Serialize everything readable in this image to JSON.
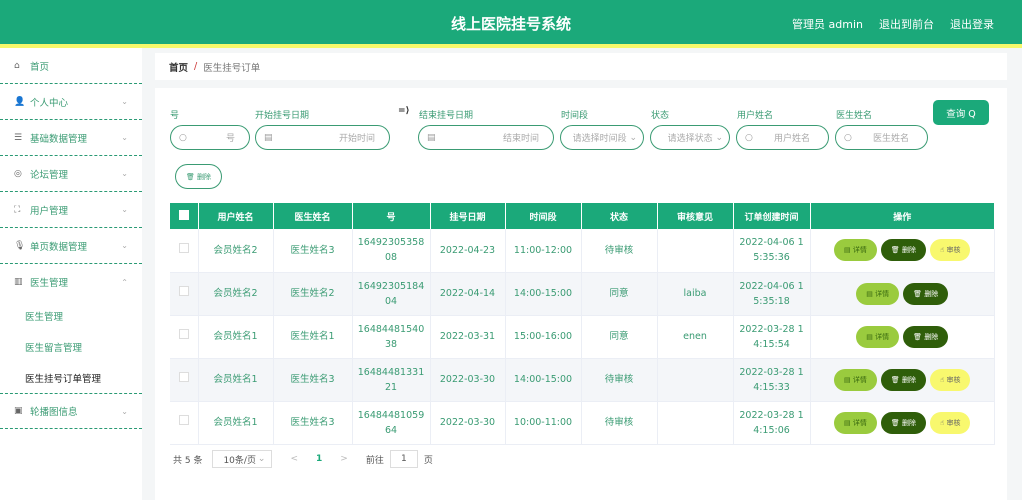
{
  "header": {
    "title": "线上医院挂号系统",
    "user": "管理员 admin",
    "front": "退出到前台",
    "logout": "退出登录"
  },
  "sidebar": {
    "items": [
      {
        "label": "首页",
        "icon": "home-icon",
        "glyph": "⌂"
      },
      {
        "label": "个人中心",
        "icon": "user-icon",
        "glyph": "👤"
      },
      {
        "label": "基础数据管理",
        "icon": "menu-icon",
        "glyph": "☰"
      },
      {
        "label": "论坛管理",
        "icon": "chat-icon",
        "glyph": "◎"
      },
      {
        "label": "用户管理",
        "icon": "frame-icon",
        "glyph": "⛶"
      },
      {
        "label": "单页数据管理",
        "icon": "mic-icon",
        "glyph": "🎙"
      },
      {
        "label": "医生管理",
        "icon": "chart-icon",
        "glyph": "▥"
      }
    ],
    "subitems": [
      "医生管理",
      "医生留言管理",
      "医生挂号订单管理"
    ],
    "last": {
      "label": "轮播图信息",
      "icon": "image-icon",
      "glyph": "▣"
    }
  },
  "breadcrumb": {
    "home": "首页",
    "sep": "/",
    "current": "医生挂号订单"
  },
  "filters": {
    "no": {
      "label": "号",
      "placeholder": "号"
    },
    "start": {
      "label": "开始挂号日期",
      "placeholder": "开始时间"
    },
    "arrow": "=⟩",
    "end": {
      "label": "结束挂号日期",
      "placeholder": "结束时间"
    },
    "slot": {
      "label": "时间段",
      "placeholder": "请选择时间段"
    },
    "status": {
      "label": "状态",
      "placeholder": "请选择状态"
    },
    "user": {
      "label": "用户姓名",
      "placeholder": "用户姓名"
    },
    "doctor": {
      "label": "医生姓名",
      "placeholder": "医生姓名"
    },
    "query": "查询 Q",
    "delete": "🗑 删除"
  },
  "table": {
    "headers": [
      "用户姓名",
      "医生姓名",
      "号",
      "挂号日期",
      "时间段",
      "状态",
      "审核意见",
      "订单创建时间",
      "操作"
    ],
    "actions": {
      "detail": "▤ 详情",
      "delete": "🗑 删除",
      "review": "☝ 审核"
    },
    "rows": [
      {
        "user": "会员姓名2",
        "doctor": "医生姓名3",
        "no": "1649230535808",
        "date": "2022-04-23",
        "slot": "11:00-12:00",
        "status": "待审核",
        "opinion": "",
        "created": "2022-04-06 15:35:36",
        "review": true
      },
      {
        "user": "会员姓名2",
        "doctor": "医生姓名2",
        "no": "1649230518404",
        "date": "2022-04-14",
        "slot": "14:00-15:00",
        "status": "同意",
        "opinion": "laiba",
        "created": "2022-04-06 15:35:18",
        "review": false
      },
      {
        "user": "会员姓名1",
        "doctor": "医生姓名1",
        "no": "1648448154038",
        "date": "2022-03-31",
        "slot": "15:00-16:00",
        "status": "同意",
        "opinion": "enen",
        "created": "2022-03-28 14:15:54",
        "review": false
      },
      {
        "user": "会员姓名1",
        "doctor": "医生姓名3",
        "no": "1648448133121",
        "date": "2022-03-30",
        "slot": "14:00-15:00",
        "status": "待审核",
        "opinion": "",
        "created": "2022-03-28 14:15:33",
        "review": true
      },
      {
        "user": "会员姓名1",
        "doctor": "医生姓名3",
        "no": "1648448105964",
        "date": "2022-03-30",
        "slot": "10:00-11:00",
        "status": "待审核",
        "opinion": "",
        "created": "2022-03-28 14:15:06",
        "review": true
      }
    ]
  },
  "pagination": {
    "total": "共 5 条",
    "size": "10条/页",
    "prev": "<",
    "page": "1",
    "next": ">",
    "goto": "前往",
    "goto_value": "1",
    "page_unit": "页"
  }
}
